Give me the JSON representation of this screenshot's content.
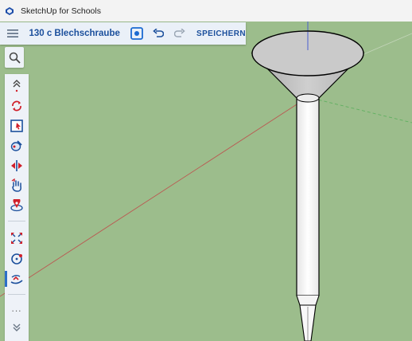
{
  "window": {
    "title": "SketchUp for Schools"
  },
  "toolbar": {
    "model_name": "130 c Blechschraube",
    "save_label": "SPEICHERN",
    "accent": "#1b4f9c"
  },
  "sidebar": {
    "tools": [
      {
        "name": "search-icon"
      },
      {
        "name": "collapse-up-icon"
      },
      {
        "name": "orbit-icon"
      },
      {
        "name": "select-icon"
      },
      {
        "name": "paint-bucket-icon"
      },
      {
        "name": "flip-icon"
      },
      {
        "name": "hand-pan-icon"
      },
      {
        "name": "position-camera-icon"
      },
      {
        "name": "scale-icon"
      },
      {
        "name": "circle-icon"
      },
      {
        "name": "follow-me-icon",
        "active": true
      },
      {
        "name": "more-icon"
      },
      {
        "name": "expand-down-icon"
      }
    ],
    "more_label": "..."
  },
  "scene": {
    "ground_color": "#9cbd8c",
    "axis_red": "#c04848",
    "axis_green": "#5fb060",
    "axis_blue": "#4a5fd0"
  }
}
